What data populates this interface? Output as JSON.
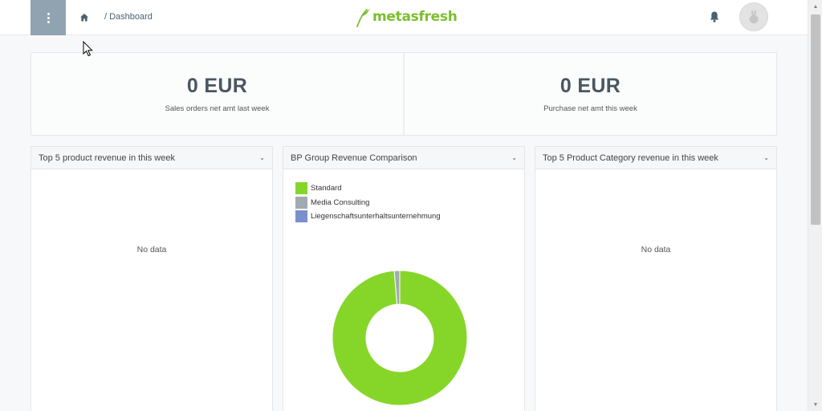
{
  "header": {
    "breadcrumb": "/ Dashboard",
    "logo_text": "metasfresh",
    "menu_icon": "kebab-menu-icon",
    "home_icon": "home-icon",
    "bell_icon": "bell-icon",
    "avatar_icon": "avatar-icon"
  },
  "kpis": [
    {
      "value": "0 EUR",
      "label": "Sales orders net amt last week"
    },
    {
      "value": "0 EUR",
      "label": "Purchase net amt this week"
    }
  ],
  "widgets": [
    {
      "title": "Top 5 product revenue in this week",
      "empty_text": "No data"
    },
    {
      "title": "BP Group Revenue Comparison"
    },
    {
      "title": "Top 5 Product Category revenue in this week",
      "empty_text": "No data"
    }
  ],
  "colors": {
    "accent": "#8fa3b1",
    "brand": "#7bbe2c"
  },
  "chart_data": {
    "type": "pie",
    "title": "BP Group Revenue Comparison",
    "legend_position": "top-left",
    "categories": [
      "Standard",
      "Media Consulting",
      "Liegenschaftsunterhaltsunternehmung"
    ],
    "values": [
      98.7,
      1.3,
      0
    ],
    "colors": [
      "#86d62a",
      "#a2aab1",
      "#7a8fcb"
    ]
  }
}
